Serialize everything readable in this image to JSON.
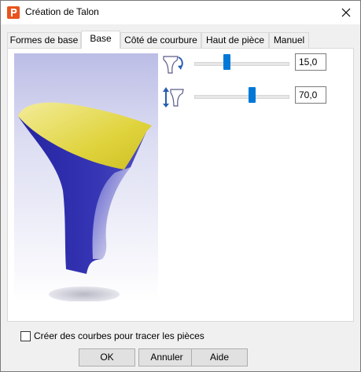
{
  "window": {
    "title": "Création de Talon"
  },
  "tabs": [
    {
      "label": "Formes de base"
    },
    {
      "label": "Base"
    },
    {
      "label": "Côté de courbure"
    },
    {
      "label": "Haut de pièce"
    },
    {
      "label": "Manuel"
    }
  ],
  "active_tab": "Base",
  "sliders": [
    {
      "icon": "heel-rotate-icon",
      "value": "15,0",
      "level": 0.35
    },
    {
      "icon": "heel-height-icon",
      "value": "70,0",
      "level": 0.62
    }
  ],
  "options": {
    "create_curves_label": "Créer des courbes pour tracer les pièces",
    "create_curves_checked": false
  },
  "buttons": {
    "ok": "OK",
    "cancel": "Annuler",
    "help": "Aide"
  },
  "colors": {
    "accent": "#0078d7",
    "heel_top": "#e8d84a",
    "heel_body": "#2a2aa0"
  }
}
